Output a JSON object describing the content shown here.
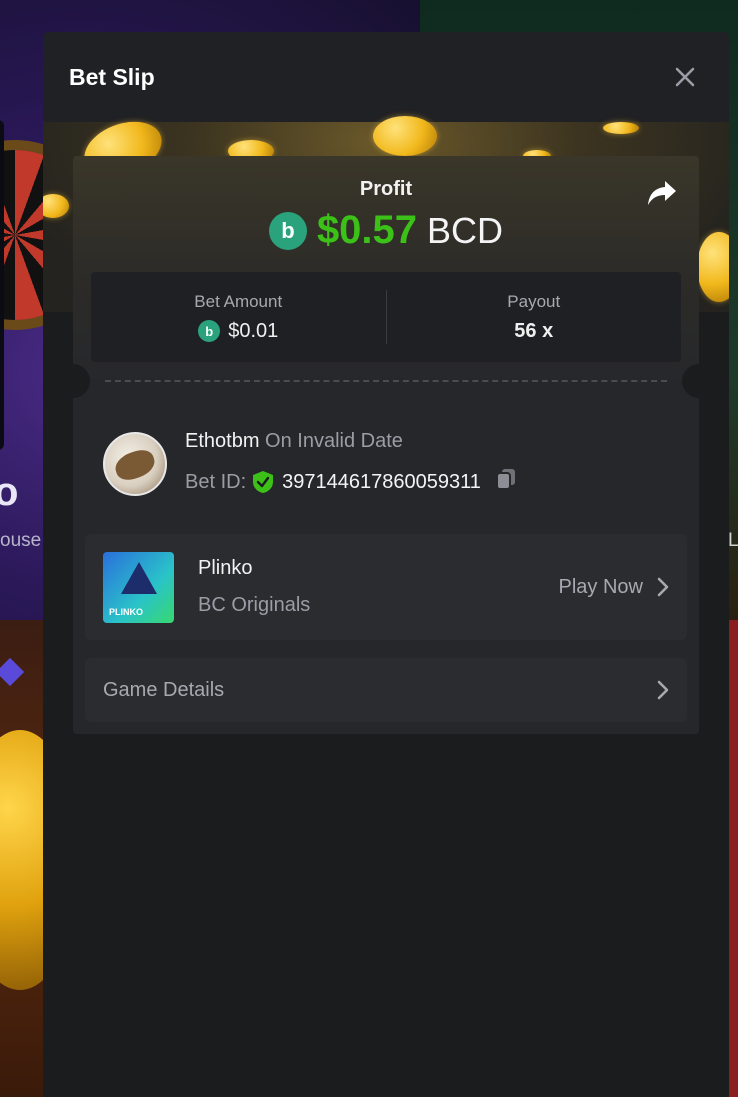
{
  "modal": {
    "title": "Bet Slip"
  },
  "profit": {
    "label": "Profit",
    "value": "$0.57",
    "currency": "BCD",
    "value_color": "#3bc117",
    "coin_symbol": "b"
  },
  "stats": {
    "bet_amount_label": "Bet Amount",
    "bet_amount_value": "$0.01",
    "payout_label": "Payout",
    "payout_value": "56 x"
  },
  "user": {
    "name": "Ethotbm",
    "date": "On Invalid Date",
    "bet_id_label": "Bet ID:",
    "bet_id": "397144617860059311"
  },
  "game": {
    "name": "Plinko",
    "provider": "BC Originals",
    "play_label": "Play Now",
    "thumb_text": "PLINKO"
  },
  "details": {
    "label": "Game Details"
  },
  "background": {
    "big_text": "o",
    "small_text": "ouse",
    "right_text": "L"
  },
  "colors": {
    "accent_green": "#3bc117",
    "coin_teal": "#2aa37c",
    "panel": "#26272b",
    "modal": "#1b1c1e"
  },
  "icons": {
    "close": "close-icon",
    "share": "share-icon",
    "coin": "bcd-coin-icon",
    "shield": "verified-shield-icon",
    "copy": "copy-icon",
    "chevron": "chevron-right-icon"
  }
}
